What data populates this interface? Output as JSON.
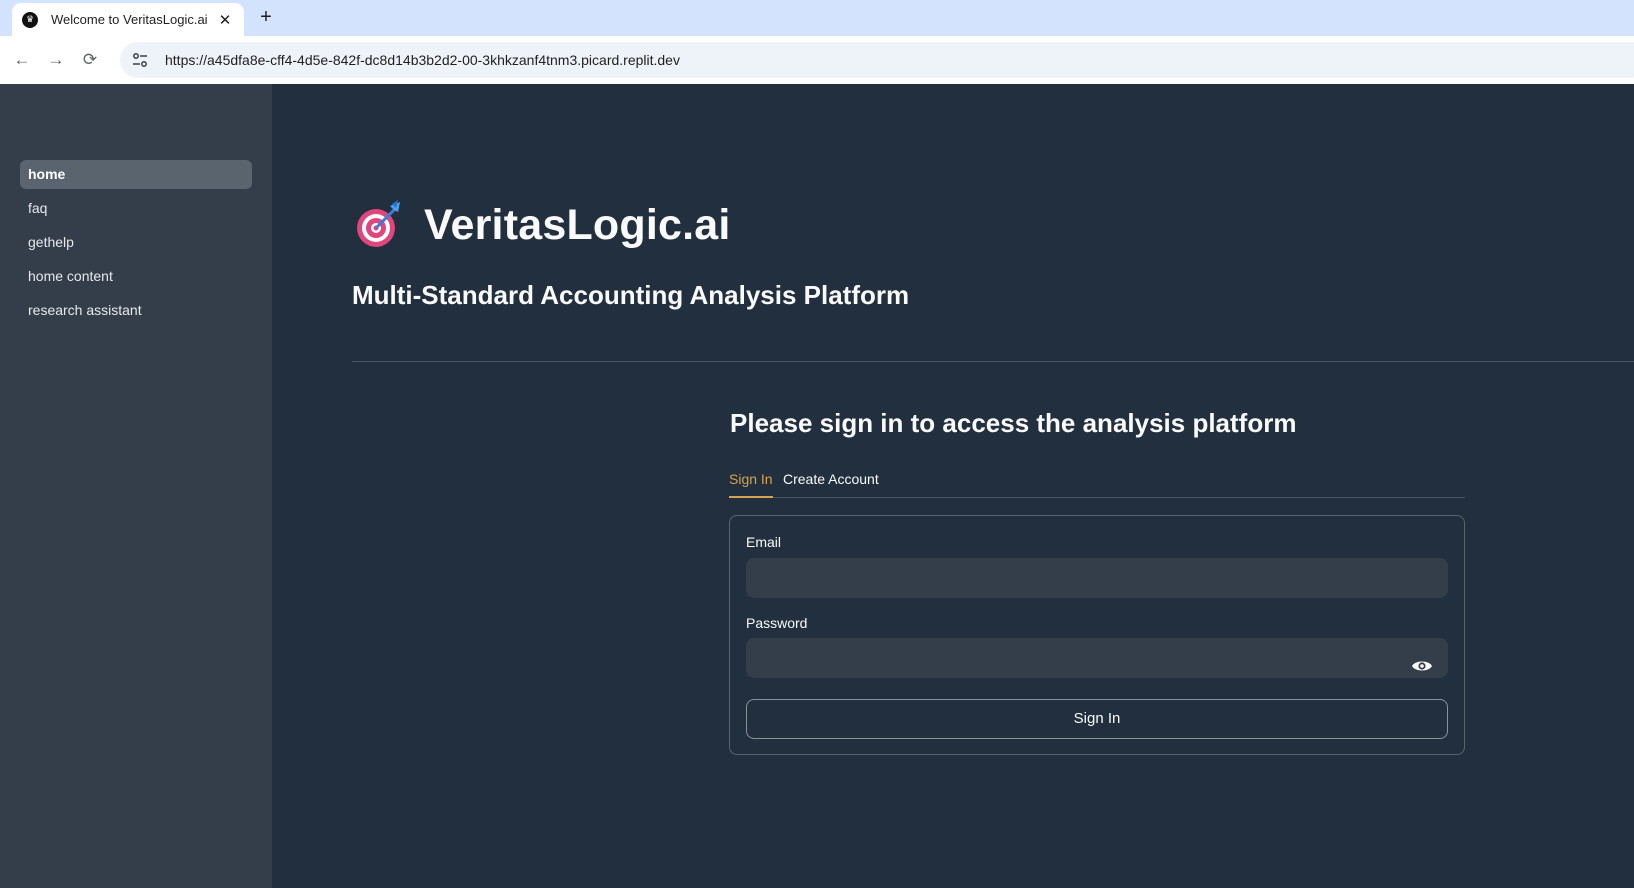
{
  "browser": {
    "tab_title": "Welcome to VeritasLogic.ai",
    "close_glyph": "✕",
    "newtab_glyph": "+",
    "url": "https://a45dfa8e-cff4-4d5e-842f-dc8d14b3b2d2-00-3khkzanf4tnm3.picard.replit.dev",
    "back_glyph": "←",
    "forward_glyph": "→",
    "reload_glyph": "⟳"
  },
  "sidebar": {
    "items": [
      {
        "label": "home",
        "active": true
      },
      {
        "label": "faq",
        "active": false
      },
      {
        "label": "gethelp",
        "active": false
      },
      {
        "label": "home content",
        "active": false
      },
      {
        "label": "research assistant",
        "active": false
      }
    ]
  },
  "main": {
    "brand": "VeritasLogic.ai",
    "logo_icon": "target-dart-icon",
    "subtitle": "Multi-Standard Accounting Analysis Platform",
    "signin_heading": "Please sign in to access the analysis platform",
    "tabs": [
      {
        "label": "Sign In",
        "active": true
      },
      {
        "label": "Create Account",
        "active": false
      }
    ],
    "form": {
      "email_label": "Email",
      "email_value": "",
      "password_label": "Password",
      "password_value": "",
      "submit_label": "Sign In"
    }
  },
  "colors": {
    "sidebar_bg": "#343e4a",
    "main_bg": "#212f3e",
    "accent": "#d7a34f",
    "text": "#fafafa"
  }
}
